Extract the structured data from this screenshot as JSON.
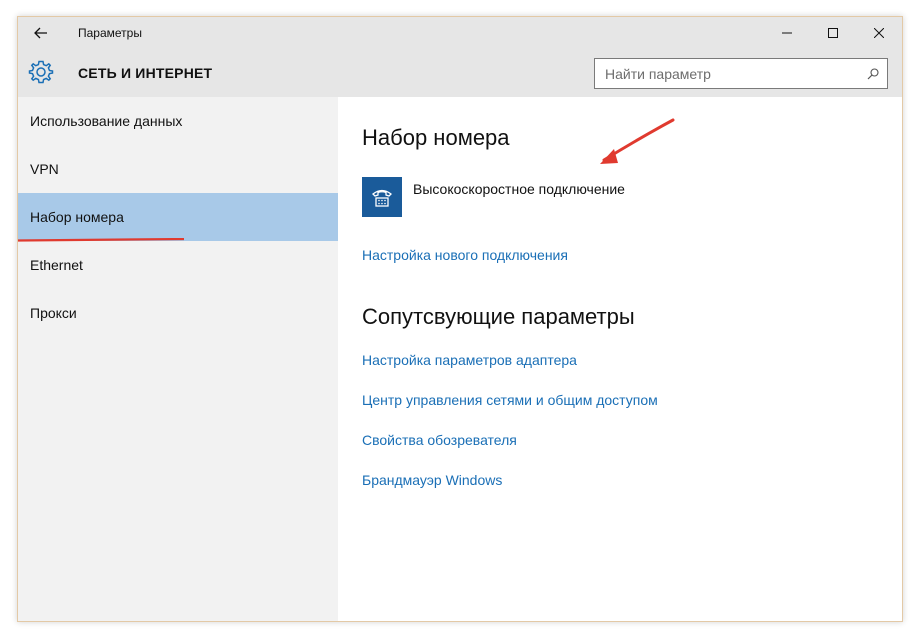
{
  "window": {
    "app_title": "Параметры"
  },
  "header": {
    "section_title": "СЕТЬ И ИНТЕРНЕТ",
    "search_placeholder": "Найти параметр"
  },
  "sidebar": {
    "items": [
      {
        "label": "Использование данных",
        "active": false
      },
      {
        "label": "VPN",
        "active": false
      },
      {
        "label": "Набор номера",
        "active": true
      },
      {
        "label": "Ethernet",
        "active": false
      },
      {
        "label": "Прокси",
        "active": false
      }
    ]
  },
  "main": {
    "title": "Набор номера",
    "connection_name": "Высокоскоростное подключение",
    "setup_link": "Настройка нового подключения",
    "related_title": "Сопутсвующие параметры",
    "related_links": [
      "Настройка параметров адаптера",
      "Центр управления сетями и общим доступом",
      "Свойства обозревателя",
      "Брандмауэр Windows"
    ]
  },
  "colors": {
    "accent": "#1a6fb6",
    "active_item": "#a8c9e8",
    "tile": "#1a5b9a",
    "annotation": "#e03a2f"
  },
  "icons": [
    "back-arrow-icon",
    "minimize-icon",
    "maximize-icon",
    "close-icon",
    "gear-icon",
    "search-icon",
    "dialup-phone-icon"
  ]
}
